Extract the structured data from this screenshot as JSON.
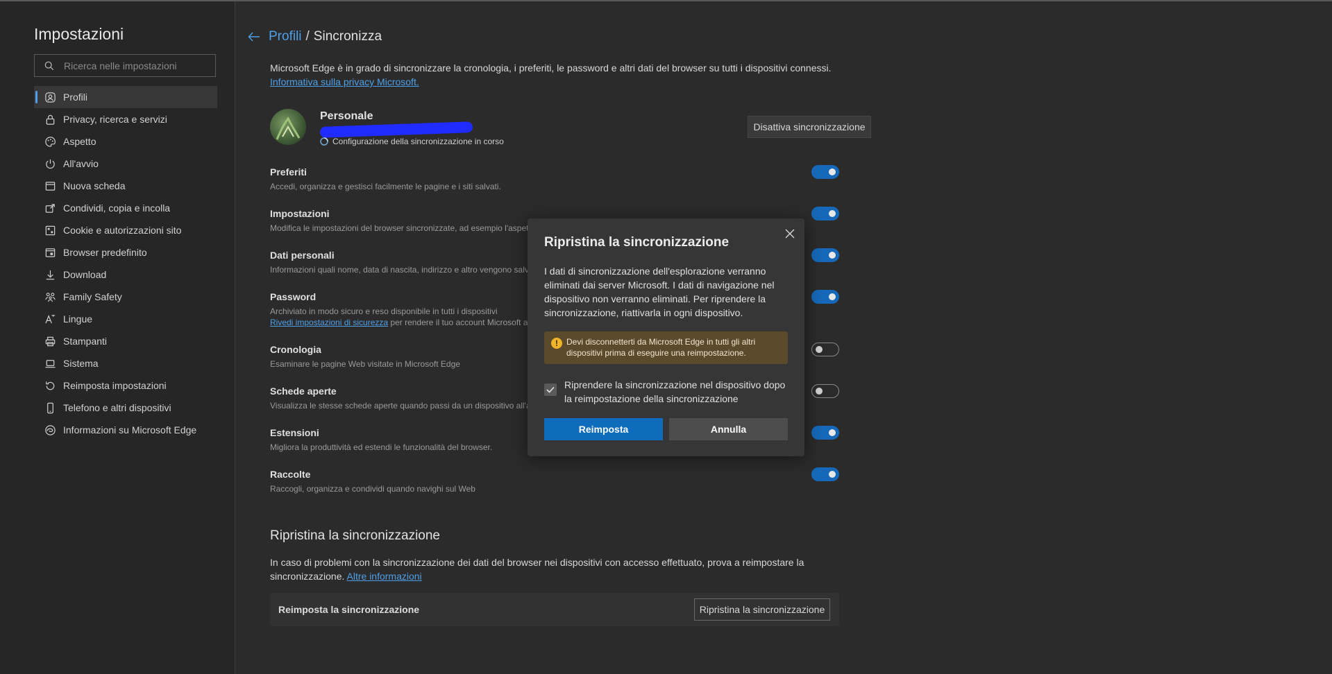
{
  "sidebar": {
    "title": "Impostazioni",
    "search_placeholder": "Ricerca nelle impostazioni",
    "items": [
      {
        "label": "Profili",
        "icon": "profile-icon"
      },
      {
        "label": "Privacy, ricerca e servizi",
        "icon": "lock-icon"
      },
      {
        "label": "Aspetto",
        "icon": "palette-icon"
      },
      {
        "label": "All'avvio",
        "icon": "power-icon"
      },
      {
        "label": "Nuova scheda",
        "icon": "new-tab-icon"
      },
      {
        "label": "Condividi, copia e incolla",
        "icon": "share-icon"
      },
      {
        "label": "Cookie e autorizzazioni sito",
        "icon": "cookie-icon"
      },
      {
        "label": "Browser predefinito",
        "icon": "browser-icon"
      },
      {
        "label": "Download",
        "icon": "download-icon"
      },
      {
        "label": "Family Safety",
        "icon": "family-icon"
      },
      {
        "label": "Lingue",
        "icon": "language-icon"
      },
      {
        "label": "Stampanti",
        "icon": "printer-icon"
      },
      {
        "label": "Sistema",
        "icon": "laptop-icon"
      },
      {
        "label": "Reimposta impostazioni",
        "icon": "reset-icon"
      },
      {
        "label": "Telefono e altri dispositivi",
        "icon": "phone-icon"
      },
      {
        "label": "Informazioni su Microsoft Edge",
        "icon": "edge-icon"
      }
    ]
  },
  "breadcrumb": {
    "parent": "Profili",
    "separator": "/",
    "current": "Sincronizza"
  },
  "intro": {
    "text": "Microsoft Edge è in grado di sincronizzare la cronologia, i preferiti, le password e altri dati del browser su tutti i dispositivi connessi.",
    "link": "Informativa sulla privacy Microsoft."
  },
  "profile": {
    "name": "Personale",
    "status": "Configurazione della sincronizzazione in corso",
    "disable_button": "Disattiva sincronizzazione"
  },
  "sync_items": [
    {
      "title": "Preferiti",
      "desc": "Accedi, organizza e gestisci facilmente le pagine e i siti salvati.",
      "on": true
    },
    {
      "title": "Impostazioni",
      "desc": "Modifica le impostazioni del browser sincronizzate, ad esempio l'aspet",
      "on": true
    },
    {
      "title": "Dati personali",
      "desc": "Informazioni quali nome, data di nascita, indirizzo e altro vengono salv",
      "on": true
    },
    {
      "title": "Password",
      "desc": "Archiviato in modo sicuro e reso disponibile in tutti i dispositivi",
      "desc_link": "Rivedi impostazioni di sicurezza",
      "desc_tail": " per rendere il tuo account Microsoft a",
      "on": true
    },
    {
      "title": "Cronologia",
      "desc": "Esaminare le pagine Web visitate in Microsoft Edge",
      "on": false
    },
    {
      "title": "Schede aperte",
      "desc": "Visualizza le stesse schede aperte quando passi da un dispositivo all'al",
      "on": false
    },
    {
      "title": "Estensioni",
      "desc": "Migliora la produttività ed estendi le funzionalità del browser.",
      "on": true
    },
    {
      "title": "Raccolte",
      "desc": "Raccogli, organizza e condividi quando navighi sul Web",
      "on": true
    }
  ],
  "reset_section": {
    "title": "Ripristina la sincronizzazione",
    "desc": "In caso di problemi con la sincronizzazione dei dati del browser nei dispositivi con accesso effettuato, prova a reimpostare la sincronizzazione.",
    "link": "Altre informazioni",
    "box_label": "Reimposta la sincronizzazione",
    "button": "Ripristina la sincronizzazione"
  },
  "dialog": {
    "title": "Ripristina la sincronizzazione",
    "body": "I dati di sincronizzazione dell'esplorazione verranno eliminati dai server Microsoft. I dati di navigazione nel dispositivo non verranno eliminati. Per riprendere la sincronizzazione, riattivarla in ogni dispositivo.",
    "warning": "Devi disconnetterti da Microsoft Edge in tutti gli altri dispositivi prima di eseguire una reimpostazione.",
    "checkbox_label": "Riprendere la sincronizzazione nel dispositivo dopo la reimpostazione della sincronizzazione",
    "checkbox_checked": true,
    "primary_button": "Reimposta",
    "secondary_button": "Annulla"
  },
  "colors": {
    "accent": "#4ea0e8",
    "toggle_on": "#1668b8",
    "primary_button": "#0f6cbd",
    "warning_bg": "#5b4a2c"
  }
}
